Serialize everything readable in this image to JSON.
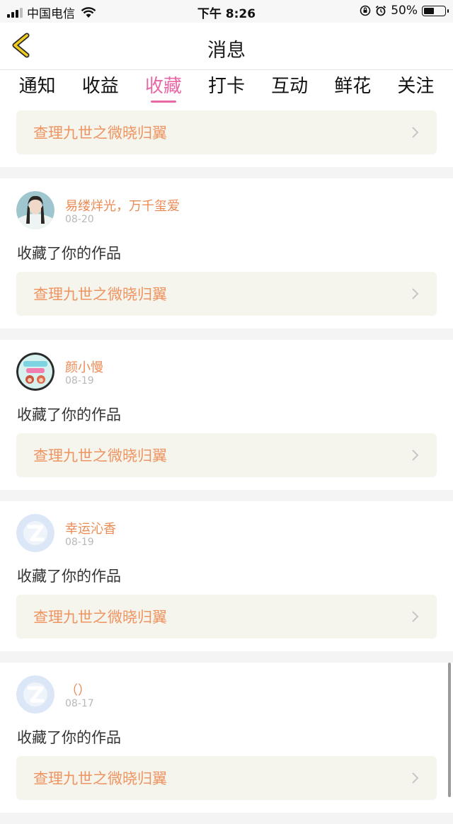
{
  "status_bar": {
    "carrier": "中国电信",
    "time": "下午 8:26",
    "battery_percent": "50%",
    "battery_level": 0.5,
    "icons": [
      "signal-icon",
      "wifi-icon",
      "orientation-lock-icon",
      "alarm-icon",
      "battery-icon"
    ]
  },
  "navbar": {
    "title": "消息",
    "back_icon": "chevron-left-icon",
    "accent_color": "#f2cc1e"
  },
  "tabs": [
    {
      "label": "通知",
      "active": false
    },
    {
      "label": "收益",
      "active": false
    },
    {
      "label": "收藏",
      "active": true
    },
    {
      "label": "打卡",
      "active": false
    },
    {
      "label": "互动",
      "active": false
    },
    {
      "label": "鲜花",
      "active": false
    },
    {
      "label": "关注",
      "active": false
    }
  ],
  "colors": {
    "active_tab": "#e868a6",
    "username": "#ec8a54",
    "work_title": "#ee9460",
    "work_bg": "#f5f4ed"
  },
  "first_card": {
    "work_title": "查理九世之微晓归翼"
  },
  "messages": [
    {
      "username": "易缕烊光，万千玺爱",
      "date": "08-20",
      "action": "收藏了你的作品",
      "work_title": "查理九世之微晓归翼",
      "avatar": "photo-avatar"
    },
    {
      "username": "颜小慢",
      "date": "08-19",
      "action": "收藏了你的作品",
      "work_title": "查理九世之微晓归翼",
      "avatar": "cartoon-avatar"
    },
    {
      "username": "幸运沁香",
      "date": "08-19",
      "action": "收藏了你的作品",
      "work_title": "查理九世之微晓归翼",
      "avatar": "default-qq-avatar"
    },
    {
      "username": "（）",
      "date": "08-17",
      "action": "收藏了你的作品",
      "work_title": "查理九世之微晓归翼",
      "avatar": "default-qq-avatar"
    }
  ]
}
